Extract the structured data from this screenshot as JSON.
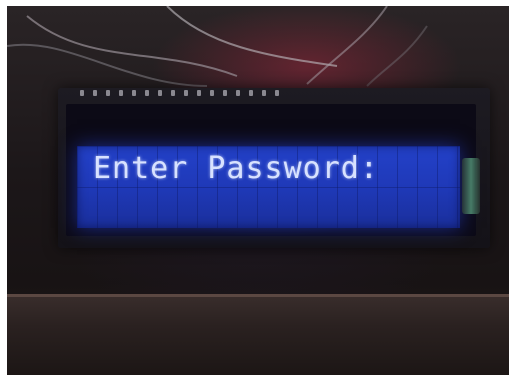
{
  "lcd": {
    "line1": "Enter Password:",
    "line2": ""
  },
  "colors": {
    "backlight": "#2341c9",
    "character": "#d8e2ff",
    "pcb": "#141218",
    "background": "#1c1719"
  }
}
